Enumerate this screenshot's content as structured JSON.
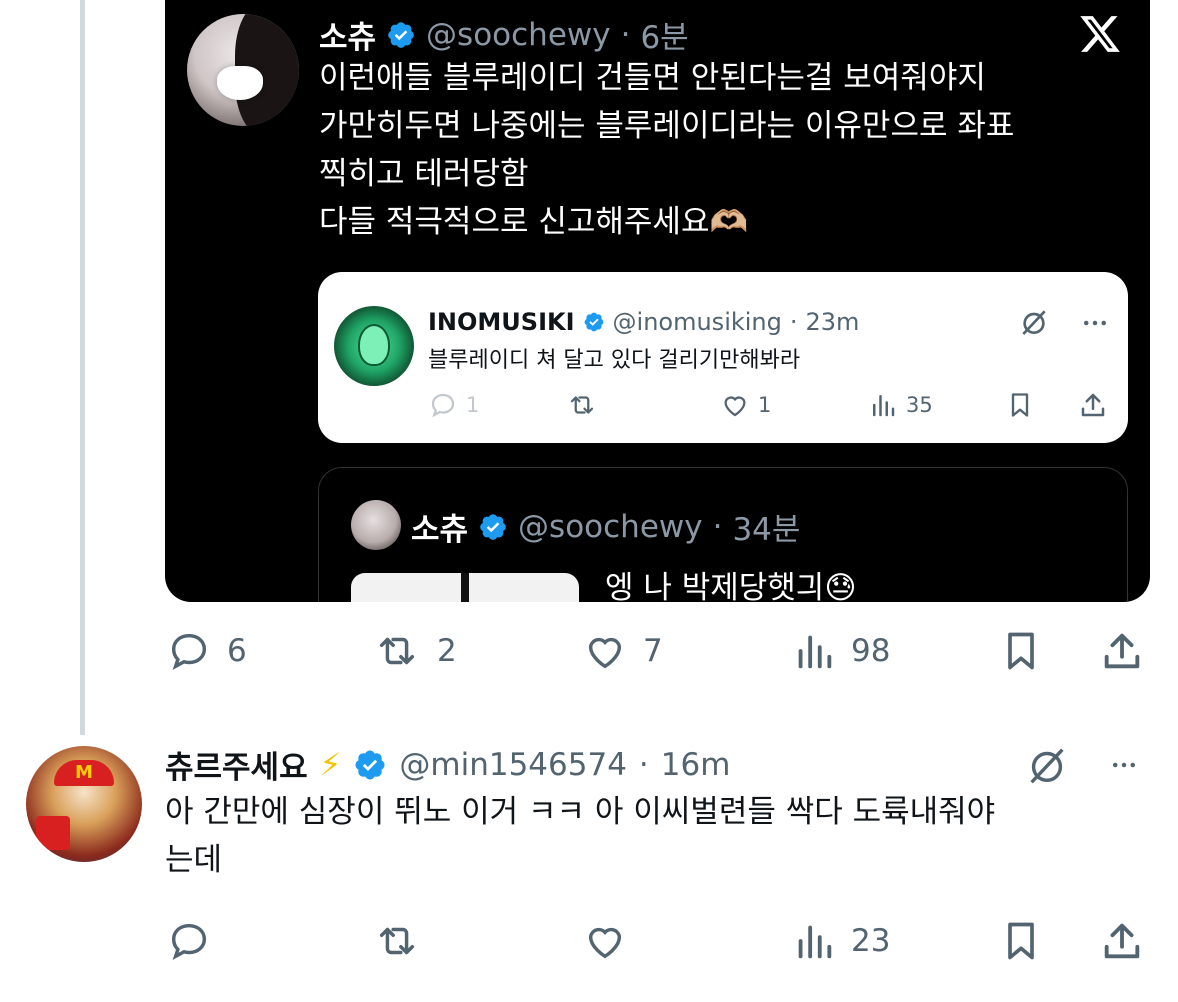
{
  "quoted_screenshot": {
    "author_name": "소츄",
    "author_handle": "@soochewy",
    "time": "6분",
    "text_lines": [
      "이런애들 블루레이디 건들면 안된다는걸 보여줘야지",
      "가만히두면 나중에는 블루레이디라는 이유만으로 좌표",
      "찍히고 테러당함",
      "다들 적극적으로 신고해주세요🫶🏼"
    ],
    "quoted_card": {
      "author_name": "INOMUSIKI",
      "author_handle": "@inomusiking",
      "time": "23m",
      "text": "블루레이디 쳐 달고 있다 걸리기만해봐라",
      "replies": "1",
      "likes": "1",
      "views": "35"
    },
    "nested_card": {
      "author_name": "소츄",
      "author_handle": "@soochewy",
      "time": "34분",
      "text": "엥 나 박제당햇긔😓"
    }
  },
  "main_tweet_actions": {
    "replies": "6",
    "reposts": "2",
    "likes": "7",
    "views": "98"
  },
  "reply_tweet": {
    "author_name": "츄르주세요",
    "name_emoji": "⚡",
    "author_handle": "@min1546574",
    "time": "16m",
    "text_lines": [
      "아 간만에 심장이 뛰노 이거 ㅋㅋ 아 이씨벌련들 싹다 도륙내줘야",
      "는데"
    ],
    "views": "23"
  },
  "colors": {
    "verified_blue": "#1d9bf0",
    "icon_gray": "#536471",
    "text_dark": "#0f1419"
  }
}
